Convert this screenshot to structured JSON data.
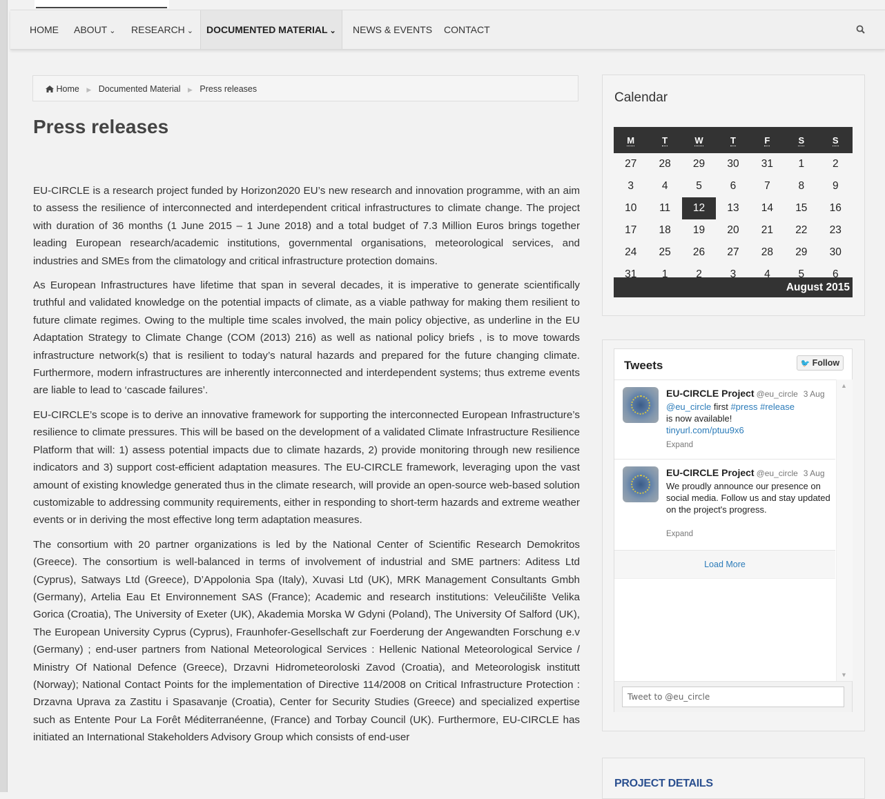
{
  "nav": {
    "items": [
      {
        "label": "HOME",
        "has_caret": false
      },
      {
        "label": "ABOUT",
        "has_caret": true
      },
      {
        "label": "RESEARCH",
        "has_caret": true
      },
      {
        "label": "DOCUMENTED MATERIAL",
        "has_caret": true,
        "active": true
      },
      {
        "label": "NEWS & EVENTS",
        "has_caret": false
      },
      {
        "label": "CONTACT",
        "has_caret": false
      }
    ],
    "caret": "⌄",
    "search_icon": "search-icon"
  },
  "breadcrumb": {
    "home_icon": "home-icon",
    "home": "Home",
    "parent": "Documented Material",
    "current": "Press releases"
  },
  "page": {
    "title": "Press releases",
    "paragraphs": [
      "EU-CIRCLE is a research project funded by Horizon2020 EU’s new research and innovation programme, with an aim to assess the resilience of interconnected and interdependent critical infrastructures to climate change. The project with duration of 36 months (1 June 2015 – 1 June 2018) and a total budget of 7.3 Million Euros brings together leading European research/academic institutions, governmental organisations, meteorological services, and industries and SMEs from the climatology and critical infrastructure protection domains.",
      "As European Infrastructures have lifetime that span in several decades, it is imperative to generate scientifically truthful and validated knowledge on the potential impacts of climate, as a viable pathway for making them resilient to future climate regimes. Owing to the multiple time scales involved, the main policy objective, as underline in the EU Adaptation Strategy to Climate Change (COM (2013) 216) as well as national policy briefs , is to move towards infrastructure network(s) that is resilient to today’s natural hazards and prepared for the future changing climate. Furthermore, modern infrastructures are inherently interconnected and interdependent systems; thus extreme events are liable to lead to ‘cascade failures’.",
      "EU-CIRCLE’s scope is to derive an innovative framework for supporting the interconnected European Infrastructure’s resilience to climate pressures. This will be based on the development of a validated Climate Infrastructure Resilience Platform that will: 1) assess potential impacts due to climate hazards, 2) provide monitoring through new resilience indicators and 3) support cost-efficient adaptation measures. The EU-CIRCLE framework, leveraging upon the vast amount of existing knowledge generated thus in the climate research, will provide an open-source web-based solution customizable to addressing community requirements, either in responding to short-term hazards and extreme weather events or in deriving the most effective long term adaptation measures.",
      "The consortium with 20 partner organizations is led by the National Center of Scientific Research Demokritos (Greece). The consortium is well-balanced in terms of involvement of industrial and SME partners: Aditess Ltd (Cyprus), Satways Ltd (Greece), D’Appolonia Spa (Italy), Xuvasi Ltd (UK), MRK Management Consultants Gmbh (Germany), Artelia Eau Et Environnement SAS (France); Academic and research institutions: Veleučilište Velika Gorica (Croatia), The University of Exeter (UK), Akademia Morska W Gdyni (Poland), The University Of Salford (UK), The European University Cyprus (Cyprus), Fraunhofer-Gesellschaft zur Foerderung der Angewandten Forschung e.v (Germany) ; end-user partners from National Meteorological Services : Hellenic National Meteorological Service / Ministry Of National Defence (Greece), Drzavni Hidrometeoroloski Zavod (Croatia), and Meteorologisk institutt (Norway); National Contact Points for the implementation of Directive 114/2008 on Critical Infrastructure Protection : Drzavna Uprava za Zastitu i Spasavanje (Croatia), Center for Security Studies (Greece) and specialized expertise such as Entente Pour La Forêt Méditerranéenne, (France) and Torbay Council (UK). Furthermore, EU-CIRCLE has initiated an International Stakeholders Advisory Group which consists of end-user"
    ]
  },
  "calendar": {
    "title": "Calendar",
    "weekdays": [
      "M",
      "T",
      "W",
      "T",
      "F",
      "S",
      "S"
    ],
    "weeks": [
      [
        "27",
        "28",
        "29",
        "30",
        "31",
        "1",
        "2"
      ],
      [
        "3",
        "4",
        "5",
        "6",
        "7",
        "8",
        "9"
      ],
      [
        "10",
        "11",
        "12",
        "13",
        "14",
        "15",
        "16"
      ],
      [
        "17",
        "18",
        "19",
        "20",
        "21",
        "22",
        "23"
      ],
      [
        "24",
        "25",
        "26",
        "27",
        "28",
        "29",
        "30"
      ],
      [
        "31",
        "1",
        "2",
        "3",
        "4",
        "5",
        "6"
      ]
    ],
    "today": "12",
    "caption": "August 2015"
  },
  "tweets": {
    "title": "Tweets",
    "follow_label": "Follow",
    "follow_icon": "twitter-bird-icon",
    "items": [
      {
        "author": "EU-CIRCLE Project",
        "handle": "@eu_circle",
        "date": "3 Aug",
        "mention": "@eu_circle",
        "text_after_mention": "first",
        "hashtag1": "#press",
        "hashtag2": "#release",
        "text_tail": "is now available!",
        "link": "tinyurl.com/ptuu9x6",
        "expand": "Expand"
      },
      {
        "author": "EU-CIRCLE Project",
        "handle": "@eu_circle",
        "date": "3 Aug",
        "text": "We proudly announce our presence on social media. Follow us and stay updated on the project's progress.",
        "expand": "Expand"
      }
    ],
    "load_more": "Load More",
    "input_placeholder": "Tweet to @eu_circle"
  },
  "project_details": {
    "title": "PROJECT DETAILS"
  }
}
